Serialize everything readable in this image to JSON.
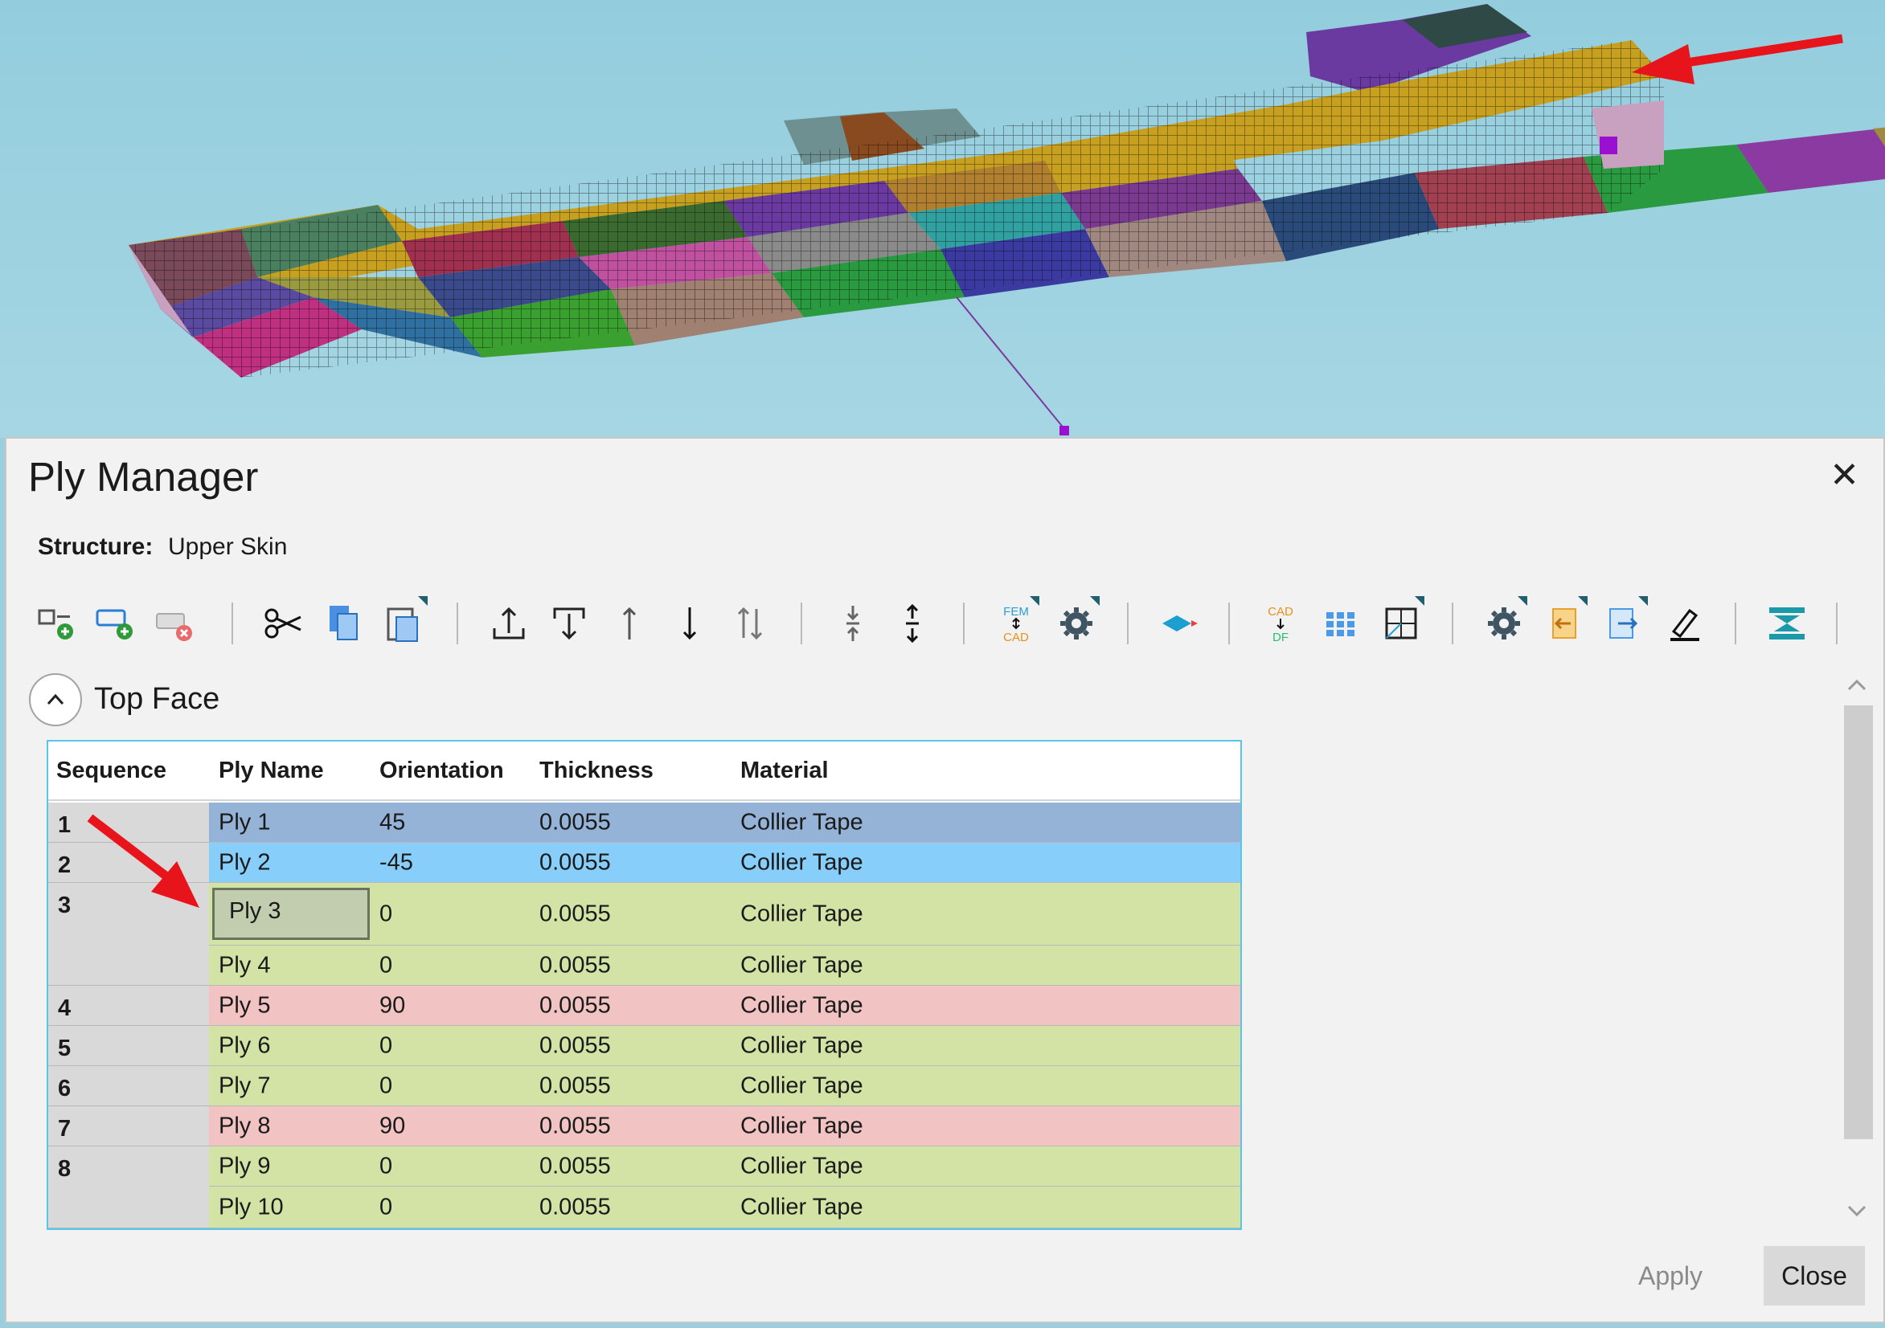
{
  "dialog": {
    "title": "Ply Manager",
    "close_glyph": "✕",
    "structure_label": "Structure:",
    "structure_value": "Upper Skin"
  },
  "toolbar": {
    "icons": [
      "add-ply-icon",
      "add-ply-set-icon",
      "delete-ply-icon",
      "cut-icon",
      "copy-icon",
      "paste-icon",
      "move-to-top-icon",
      "move-to-bottom-icon",
      "move-up-icon",
      "move-down-icon",
      "reverse-order-icon",
      "merge-sequence-icon",
      "split-sequence-icon",
      "fem-cad-sync-icon",
      "settings-icon",
      "ply-shape-icon",
      "cad-to-df-icon",
      "grid-icon",
      "mesh-cell-icon",
      "options-icon",
      "import-icon",
      "export-icon",
      "edit-icon",
      "stack-icon"
    ],
    "fem_label_top": "FEM",
    "fem_label_bottom": "CAD",
    "cad_label_top": "CAD",
    "cad_label_bottom": "DF"
  },
  "section": {
    "title": "Top Face"
  },
  "table": {
    "headers": {
      "sequence": "Sequence",
      "ply_name": "Ply Name",
      "orientation": "Orientation",
      "thickness": "Thickness",
      "material": "Material"
    },
    "sequences": [
      {
        "label": "1"
      },
      {
        "label": "2"
      },
      {
        "label": "3"
      },
      {
        "label": "4"
      },
      {
        "label": "5"
      },
      {
        "label": "6"
      },
      {
        "label": "7"
      },
      {
        "label": "8"
      }
    ],
    "rows": [
      {
        "name": "Ply 1",
        "orientation": "45",
        "thickness": "0.0055",
        "material": "Collier Tape",
        "color": "#95b3d7"
      },
      {
        "name": "Ply 2",
        "orientation": "-45",
        "thickness": "0.0055",
        "material": "Collier Tape",
        "color": "#87cefa"
      },
      {
        "name": "Ply 3",
        "orientation": "0",
        "thickness": "0.0055",
        "material": "Collier Tape",
        "color": "#d3e3a6"
      },
      {
        "name": "Ply 4",
        "orientation": "0",
        "thickness": "0.0055",
        "material": "Collier Tape",
        "color": "#d3e3a6"
      },
      {
        "name": "Ply 5",
        "orientation": "90",
        "thickness": "0.0055",
        "material": "Collier Tape",
        "color": "#f2c3c3"
      },
      {
        "name": "Ply 6",
        "orientation": "0",
        "thickness": "0.0055",
        "material": "Collier Tape",
        "color": "#d3e3a6"
      },
      {
        "name": "Ply 7",
        "orientation": "0",
        "thickness": "0.0055",
        "material": "Collier Tape",
        "color": "#d3e3a6"
      },
      {
        "name": "Ply 8",
        "orientation": "90",
        "thickness": "0.0055",
        "material": "Collier Tape",
        "color": "#f2c3c3"
      },
      {
        "name": "Ply 9",
        "orientation": "0",
        "thickness": "0.0055",
        "material": "Collier Tape",
        "color": "#d3e3a6"
      },
      {
        "name": "Ply 10",
        "orientation": "0",
        "thickness": "0.0055",
        "material": "Collier Tape",
        "color": "#d3e3a6"
      }
    ]
  },
  "footer": {
    "apply_label": "Apply",
    "close_label": "Close"
  },
  "colors": {
    "viewport_bg": "#9ccfdd",
    "annotation_arrow": "#e8141b",
    "table_border": "#58c6e8"
  }
}
